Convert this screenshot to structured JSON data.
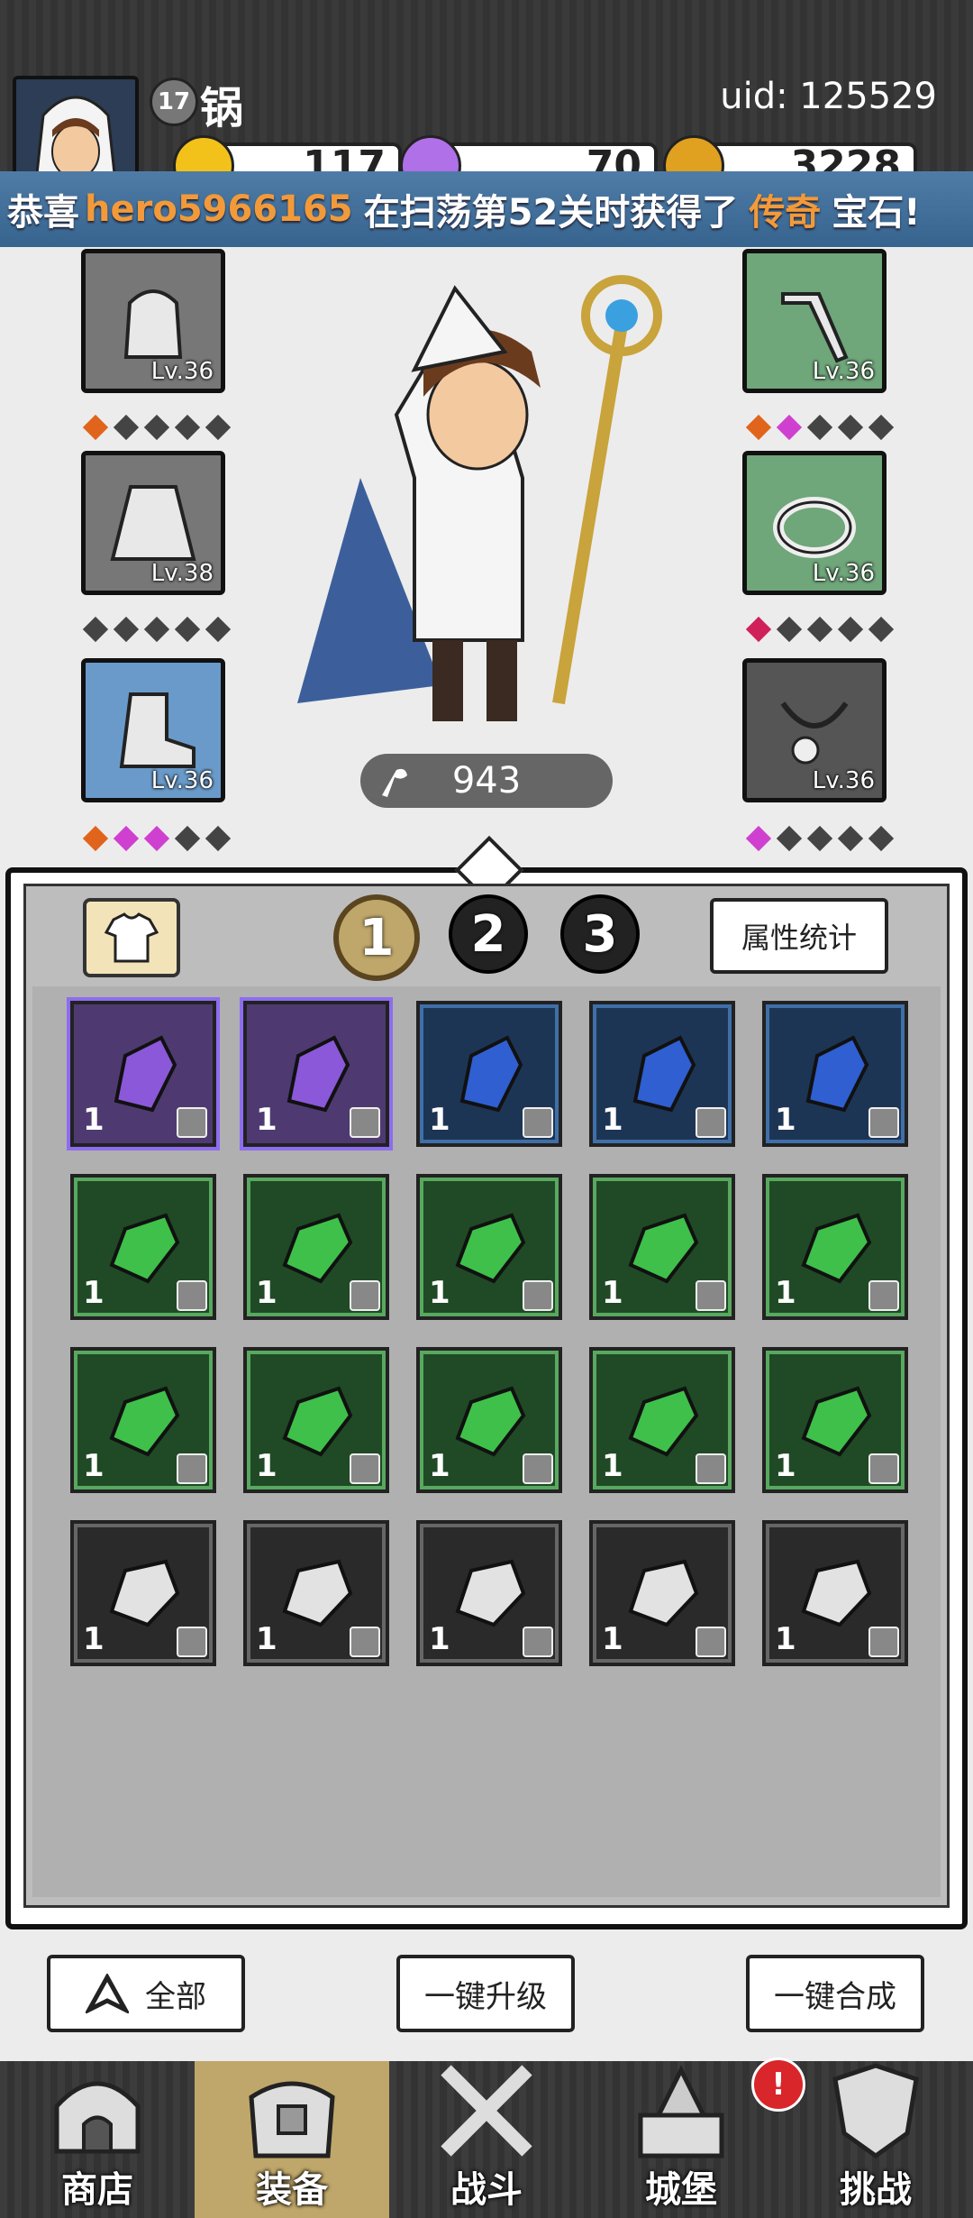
{
  "header": {
    "player_level": "17",
    "player_name": "锅",
    "uid": "uid: 125529",
    "resources": [
      {
        "name": "gold-crystal",
        "value": "117",
        "color": "#f2c21b"
      },
      {
        "name": "purple-diamond",
        "value": "70",
        "color": "#b070e8"
      },
      {
        "name": "coin",
        "value": "3228",
        "color": "#e0a020"
      }
    ]
  },
  "marquee": {
    "prefix": "恭喜",
    "player": "hero5966165",
    "middle": "在扫荡第52关时获得了",
    "item": "传奇",
    "suffix": "宝石!"
  },
  "equipment": {
    "left": [
      {
        "name": "hood",
        "level": "Lv.36",
        "bg": "gray",
        "dots": [
          "or",
          "",
          "",
          "",
          ""
        ]
      },
      {
        "name": "cloak",
        "level": "Lv.38",
        "bg": "gray",
        "dots": [
          "",
          "",
          "",
          "",
          ""
        ]
      },
      {
        "name": "boots",
        "level": "Lv.36",
        "bg": "blue",
        "dots": [
          "or",
          "pk",
          "pk",
          "",
          ""
        ]
      }
    ],
    "right": [
      {
        "name": "staff",
        "level": "Lv.36",
        "bg": "green",
        "dots": [
          "or",
          "pk",
          "",
          "",
          ""
        ]
      },
      {
        "name": "ring",
        "level": "Lv.36",
        "bg": "green",
        "dots": [
          "rd",
          "",
          "",
          "",
          ""
        ]
      },
      {
        "name": "necklace",
        "level": "Lv.36",
        "bg": "dark",
        "dots": [
          "pk",
          "",
          "",
          "",
          ""
        ]
      }
    ],
    "power": "943"
  },
  "tabs": [
    "1",
    "2",
    "3"
  ],
  "active_tab": 0,
  "stats_button": "属性统计",
  "gems": [
    [
      {
        "t": "purple",
        "c": "1"
      },
      {
        "t": "purple",
        "c": "1"
      },
      {
        "t": "blue",
        "c": "1"
      },
      {
        "t": "blue",
        "c": "1"
      },
      {
        "t": "blue",
        "c": "1"
      }
    ],
    [
      {
        "t": "green",
        "c": "1"
      },
      {
        "t": "green",
        "c": "1"
      },
      {
        "t": "green",
        "c": "1"
      },
      {
        "t": "green",
        "c": "1"
      },
      {
        "t": "green",
        "c": "1"
      }
    ],
    [
      {
        "t": "green",
        "c": "1"
      },
      {
        "t": "green",
        "c": "1"
      },
      {
        "t": "green",
        "c": "1"
      },
      {
        "t": "green",
        "c": "1"
      },
      {
        "t": "green",
        "c": "1"
      }
    ],
    [
      {
        "t": "gray",
        "c": "1"
      },
      {
        "t": "gray",
        "c": "1"
      },
      {
        "t": "gray",
        "c": "1"
      },
      {
        "t": "gray",
        "c": "1"
      },
      {
        "t": "gray",
        "c": "1"
      }
    ]
  ],
  "bottom_buttons": {
    "filter": "全部",
    "upgrade_all": "一键升级",
    "merge_all": "一键合成"
  },
  "nav": [
    {
      "label": "商店",
      "icon": "shop-icon"
    },
    {
      "label": "装备",
      "icon": "backpack-icon"
    },
    {
      "label": "战斗",
      "icon": "crossed-swords-icon"
    },
    {
      "label": "城堡",
      "icon": "castle-icon"
    },
    {
      "label": "挑战",
      "icon": "shield-icon"
    }
  ],
  "nav_active": 1,
  "castle_badge": "!"
}
